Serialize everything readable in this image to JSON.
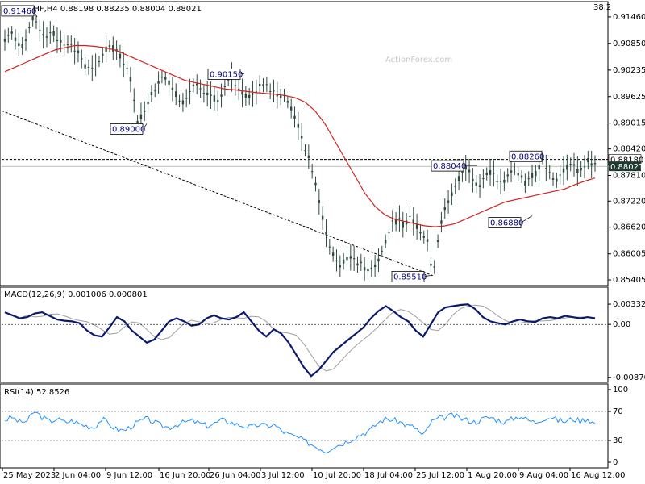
{
  "header": {
    "symbol_info": "USDCHF,H4  0.88198 0.88235 0.88004 0.88021",
    "zoom": "38.2",
    "watermark": "ActionForex.com"
  },
  "chart_data": [
    {
      "type": "candlestick",
      "title": "USDCHF,H4  0.88198 0.88235 0.88004 0.88021",
      "ylim": [
        0.8535,
        0.917
      ],
      "y_ticks": [
        "0.91460",
        "0.90850",
        "0.90235",
        "0.89625",
        "0.89015",
        "0.88420",
        "0.87810",
        "0.87220",
        "0.86620",
        "0.86005",
        "0.85405"
      ],
      "x_ticks": [
        "25 May 2023",
        "2 Jun 04:00",
        "9 Jun 12:00",
        "16 Jun 20:00",
        "26 Jun 04:00",
        "3 Jul 12:00",
        "10 Jul 20:00",
        "18 Jul 04:00",
        "25 Jul 12:00",
        "1 Aug 20:00",
        "9 Aug 04:00",
        "16 Aug 12:00"
      ],
      "current_price": "0.88021",
      "reference_level": "0.88180",
      "annotations": [
        {
          "label": "0.91460",
          "value": 0.9146
        },
        {
          "label": "0.89000",
          "value": 0.89
        },
        {
          "label": "0.90150",
          "value": 0.9015
        },
        {
          "label": "0.88040",
          "value": 0.8804
        },
        {
          "label": "0.88260",
          "value": 0.8826
        },
        {
          "label": "0.86880",
          "value": 0.8688
        },
        {
          "label": "0.85510",
          "value": 0.8551
        }
      ],
      "price_path": [
        0.9095,
        0.911,
        0.909,
        0.908,
        0.9105,
        0.9146,
        0.912,
        0.91,
        0.9115,
        0.9095,
        0.9085,
        0.909,
        0.907,
        0.906,
        0.903,
        0.902,
        0.904,
        0.906,
        0.908,
        0.907,
        0.9055,
        0.903,
        0.899,
        0.89,
        0.893,
        0.896,
        0.8985,
        0.901,
        0.9,
        0.898,
        0.896,
        0.895,
        0.8975,
        0.899,
        0.897,
        0.8965,
        0.896,
        0.895,
        0.898,
        0.9015,
        0.899,
        0.8975,
        0.896,
        0.897,
        0.8985,
        0.8995,
        0.898,
        0.897,
        0.8965,
        0.895,
        0.892,
        0.888,
        0.884,
        0.88,
        0.874,
        0.868,
        0.862,
        0.859,
        0.8575,
        0.8585,
        0.86,
        0.858,
        0.857,
        0.8565,
        0.8575,
        0.86,
        0.864,
        0.867,
        0.868,
        0.8665,
        0.869,
        0.867,
        0.865,
        0.863,
        0.8551,
        0.865,
        0.87,
        0.873,
        0.876,
        0.879,
        0.8804,
        0.877,
        0.876,
        0.878,
        0.879,
        0.877,
        0.876,
        0.878,
        0.88,
        0.878,
        0.876,
        0.878,
        0.879,
        0.8826,
        0.879,
        0.877,
        0.878,
        0.88,
        0.881,
        0.879,
        0.88,
        0.8818,
        0.8802
      ],
      "ma_path": [
        0.902,
        0.903,
        0.904,
        0.905,
        0.906,
        0.907,
        0.9075,
        0.908,
        0.908,
        0.9078,
        0.9075,
        0.907,
        0.906,
        0.905,
        0.904,
        0.903,
        0.902,
        0.901,
        0.9,
        0.8995,
        0.899,
        0.8985,
        0.898,
        0.8978,
        0.8975,
        0.8972,
        0.897,
        0.8968,
        0.8965,
        0.896,
        0.895,
        0.893,
        0.89,
        0.886,
        0.882,
        0.878,
        0.874,
        0.871,
        0.869,
        0.868,
        0.8675,
        0.867,
        0.8665,
        0.8663,
        0.8665,
        0.867,
        0.868,
        0.869,
        0.87,
        0.871,
        0.872,
        0.8725,
        0.873,
        0.8735,
        0.874,
        0.8745,
        0.875,
        0.876,
        0.8768,
        0.8775
      ]
    },
    {
      "type": "line",
      "title": "MACD(12,26,9) 0.001006 0.000801",
      "ylim": [
        -0.009,
        0.004
      ],
      "y_ticks": [
        "0.003328",
        "0.00",
        "-0.008707"
      ],
      "macd_path": [
        0.002,
        0.0015,
        0.001,
        0.0012,
        0.0018,
        0.002,
        0.0014,
        0.0008,
        0.0006,
        0.0005,
        0.0002,
        -0.001,
        -0.0018,
        -0.002,
        -0.0005,
        0.0012,
        0.0005,
        -0.001,
        -0.002,
        -0.003,
        -0.0025,
        -0.001,
        0.0005,
        0.001,
        0.0005,
        -0.0002,
        0.0,
        0.001,
        0.0015,
        0.001,
        0.0008,
        0.0012,
        0.002,
        0.0005,
        -0.001,
        -0.002,
        -0.0008,
        -0.0015,
        -0.003,
        -0.005,
        -0.007,
        -0.0085,
        -0.0075,
        -0.006,
        -0.0045,
        -0.0035,
        -0.0025,
        -0.0015,
        -0.0005,
        0.001,
        0.0022,
        0.003,
        0.0022,
        0.0012,
        0.0005,
        -0.001,
        -0.002,
        0.0,
        0.002,
        0.0028,
        0.003,
        0.0032,
        0.0033,
        0.0025,
        0.0012,
        0.0005,
        0.0002,
        0.0,
        0.0005,
        0.0008,
        0.0005,
        0.0004,
        0.001,
        0.0012,
        0.001,
        0.0014,
        0.0012,
        0.001,
        0.0012,
        0.001
      ]
    },
    {
      "type": "line",
      "title": "RSI(14) 52.8526",
      "ylim": [
        0,
        100
      ],
      "y_ticks": [
        "100",
        "70",
        "30",
        "0"
      ],
      "rsi_path": [
        58,
        62,
        55,
        57,
        70,
        62,
        56,
        60,
        55,
        57,
        53,
        50,
        48,
        60,
        52,
        45,
        44,
        50,
        56,
        60,
        55,
        50,
        48,
        52,
        55,
        57,
        54,
        50,
        53,
        58,
        56,
        52,
        50,
        48,
        52,
        50,
        52,
        44,
        38,
        35,
        30,
        25,
        20,
        15,
        22,
        25,
        30,
        35,
        40,
        45,
        55,
        60,
        58,
        55,
        50,
        48,
        35,
        55,
        60,
        62,
        65,
        60,
        58,
        55,
        60,
        62,
        58,
        55,
        60,
        64,
        58,
        55,
        60,
        62,
        58,
        56,
        60,
        57,
        60,
        53
      ]
    }
  ]
}
